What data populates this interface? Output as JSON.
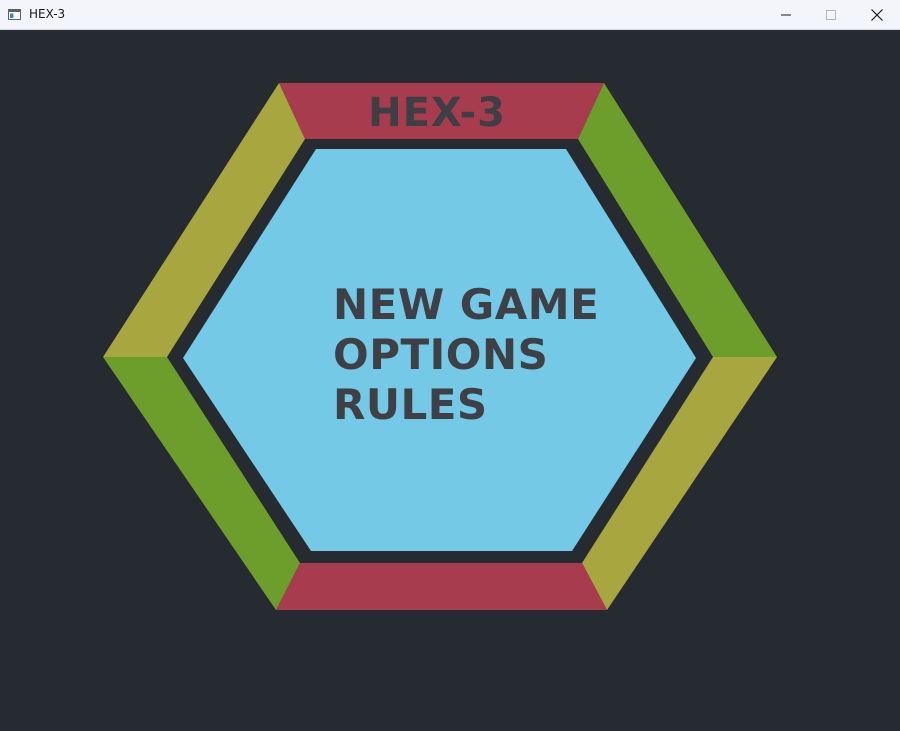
{
  "window": {
    "title": "HEX-3",
    "app_icon": "app-window-icon",
    "controls": [
      "minimize-icon",
      "maximize-icon",
      "close-icon"
    ]
  },
  "game": {
    "title": "HEX-3",
    "menu": [
      {
        "id": "new-game",
        "label": "NEW GAME"
      },
      {
        "id": "options",
        "label": "OPTIONS"
      },
      {
        "id": "rules",
        "label": "RULES"
      }
    ]
  },
  "colors": {
    "background": "#252b30",
    "center_panel": "#74c9e6",
    "side_red": "#a63c4e",
    "side_olive": "#a8a63e",
    "side_green": "#6d9e2b",
    "text": "#3e4045"
  }
}
